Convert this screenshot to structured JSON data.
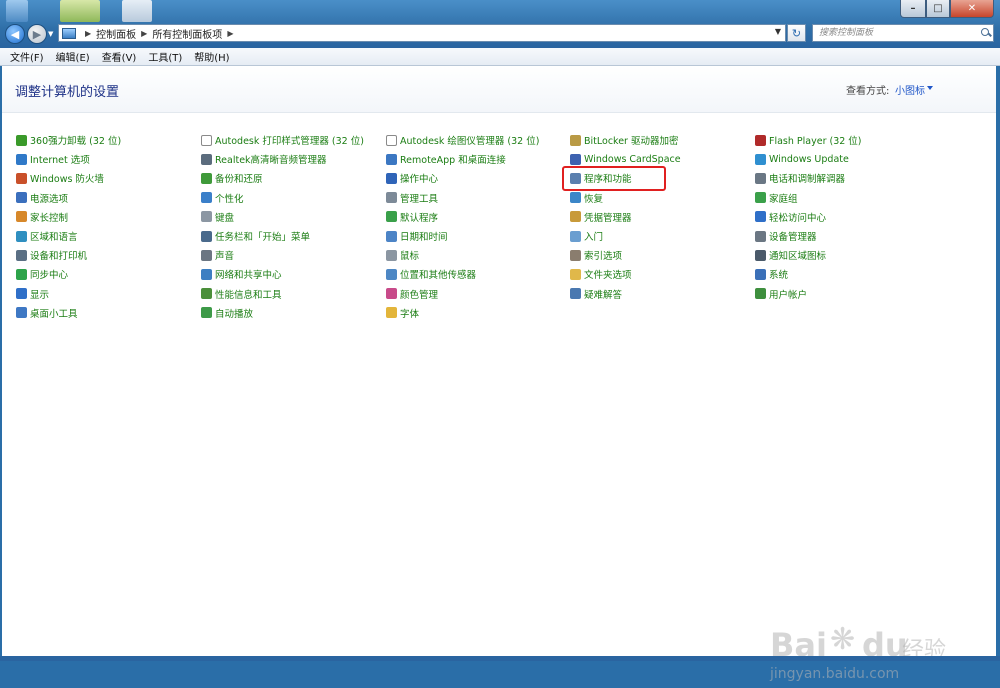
{
  "nav": {
    "breadcrumb": [
      "控制面板",
      "所有控制面板项"
    ],
    "search_placeholder": "搜索控制面板"
  },
  "menu": [
    "文件(F)",
    "编辑(E)",
    "查看(V)",
    "工具(T)",
    "帮助(H)"
  ],
  "header": {
    "title": "调整计算机的设置",
    "view_by_label": "查看方式:",
    "view_by_value": "小图标"
  },
  "columns": [
    [
      {
        "label": "360强力卸载 (32 位)",
        "icon": "uninstall-icon",
        "color": "#3a9a2a"
      },
      {
        "label": "Internet 选项",
        "icon": "globe-icon",
        "color": "#2f79c8"
      },
      {
        "label": "Windows 防火墙",
        "icon": "firewall-icon",
        "color": "#c9502a"
      },
      {
        "label": "电源选项",
        "icon": "power-icon",
        "color": "#3b6fbd"
      },
      {
        "label": "家长控制",
        "icon": "parental-icon",
        "color": "#d7882a"
      },
      {
        "label": "区域和语言",
        "icon": "region-icon",
        "color": "#2f8fc0"
      },
      {
        "label": "设备和打印机",
        "icon": "printer-icon",
        "color": "#5a6f84"
      },
      {
        "label": "同步中心",
        "icon": "sync-icon",
        "color": "#2da34a"
      },
      {
        "label": "显示",
        "icon": "display-icon",
        "color": "#2f6fc8"
      },
      {
        "label": "桌面小工具",
        "icon": "gadgets-icon",
        "color": "#3e78c4"
      }
    ],
    [
      {
        "label": "Autodesk 打印样式管理器 (32 位)",
        "icon": "document-icon",
        "color": "#ffffff"
      },
      {
        "label": "Realtek高清晰音频管理器",
        "icon": "audio-manager-icon",
        "color": "#5b6c7d"
      },
      {
        "label": "备份和还原",
        "icon": "backup-icon",
        "color": "#3f9a3a"
      },
      {
        "label": "个性化",
        "icon": "personalize-icon",
        "color": "#3a7fc9"
      },
      {
        "label": "键盘",
        "icon": "keyboard-icon",
        "color": "#8c97a3"
      },
      {
        "label": "任务栏和「开始」菜单",
        "icon": "taskbar-icon",
        "color": "#4a6a8c"
      },
      {
        "label": "声音",
        "icon": "speaker-icon",
        "color": "#6b7682"
      },
      {
        "label": "网络和共享中心",
        "icon": "network-icon",
        "color": "#3d7fc2"
      },
      {
        "label": "性能信息和工具",
        "icon": "performance-icon",
        "color": "#4b8f3a"
      },
      {
        "label": "自动播放",
        "icon": "autoplay-icon",
        "color": "#3d9a48"
      }
    ],
    [
      {
        "label": "Autodesk 绘图仪管理器 (32 位)",
        "icon": "document-icon",
        "color": "#ffffff"
      },
      {
        "label": "RemoteApp 和桌面连接",
        "icon": "remote-icon",
        "color": "#3b77c2"
      },
      {
        "label": "操作中心",
        "icon": "flag-icon",
        "color": "#2f64b8"
      },
      {
        "label": "管理工具",
        "icon": "admin-tools-icon",
        "color": "#7d8a98"
      },
      {
        "label": "默认程序",
        "icon": "default-programs-icon",
        "color": "#3aa04a"
      },
      {
        "label": "日期和时间",
        "icon": "clock-icon",
        "color": "#4c84c6"
      },
      {
        "label": "鼠标",
        "icon": "mouse-icon",
        "color": "#8b96a2"
      },
      {
        "label": "位置和其他传感器",
        "icon": "sensor-icon",
        "color": "#4d87c4"
      },
      {
        "label": "颜色管理",
        "icon": "color-icon",
        "color": "#c84a8a"
      },
      {
        "label": "字体",
        "icon": "font-icon",
        "color": "#e3b53a"
      }
    ],
    [
      {
        "label": "BitLocker 驱动器加密",
        "icon": "bitlocker-icon",
        "color": "#b99a45"
      },
      {
        "label": "Windows CardSpace",
        "icon": "cardspace-icon",
        "color": "#3d62b0"
      },
      {
        "label": "程序和功能",
        "icon": "programs-icon",
        "color": "#5a7fae"
      },
      {
        "label": "恢复",
        "icon": "recovery-icon",
        "color": "#3b86c8"
      },
      {
        "label": "凭据管理器",
        "icon": "credential-icon",
        "color": "#c89a3a"
      },
      {
        "label": "入门",
        "icon": "getting-started-icon",
        "color": "#6a9ed0"
      },
      {
        "label": "索引选项",
        "icon": "index-icon",
        "color": "#8a7d6e"
      },
      {
        "label": "文件夹选项",
        "icon": "folder-icon",
        "color": "#e0b84a"
      },
      {
        "label": "疑难解答",
        "icon": "troubleshoot-icon",
        "color": "#4a78b0"
      }
    ],
    [
      {
        "label": "Flash Player (32 位)",
        "icon": "flash-icon",
        "color": "#b02a2a"
      },
      {
        "label": "Windows Update",
        "icon": "update-icon",
        "color": "#2f8fd0"
      },
      {
        "label": "电话和调制解调器",
        "icon": "phone-icon",
        "color": "#6a7784"
      },
      {
        "label": "家庭组",
        "icon": "homegroup-icon",
        "color": "#3aa04a"
      },
      {
        "label": "轻松访问中心",
        "icon": "ease-of-access-icon",
        "color": "#2f6fc8"
      },
      {
        "label": "设备管理器",
        "icon": "device-manager-icon",
        "color": "#6b7783"
      },
      {
        "label": "通知区域图标",
        "icon": "notify-icon",
        "color": "#4a5a6a"
      },
      {
        "label": "系统",
        "icon": "system-icon",
        "color": "#3b70b8"
      },
      {
        "label": "用户帐户",
        "icon": "users-icon",
        "color": "#3e8f3e"
      }
    ]
  ],
  "watermark": {
    "brand": "Bai",
    "brand2": "du",
    "cn": "经验",
    "url": "jingyan.baidu.com"
  }
}
